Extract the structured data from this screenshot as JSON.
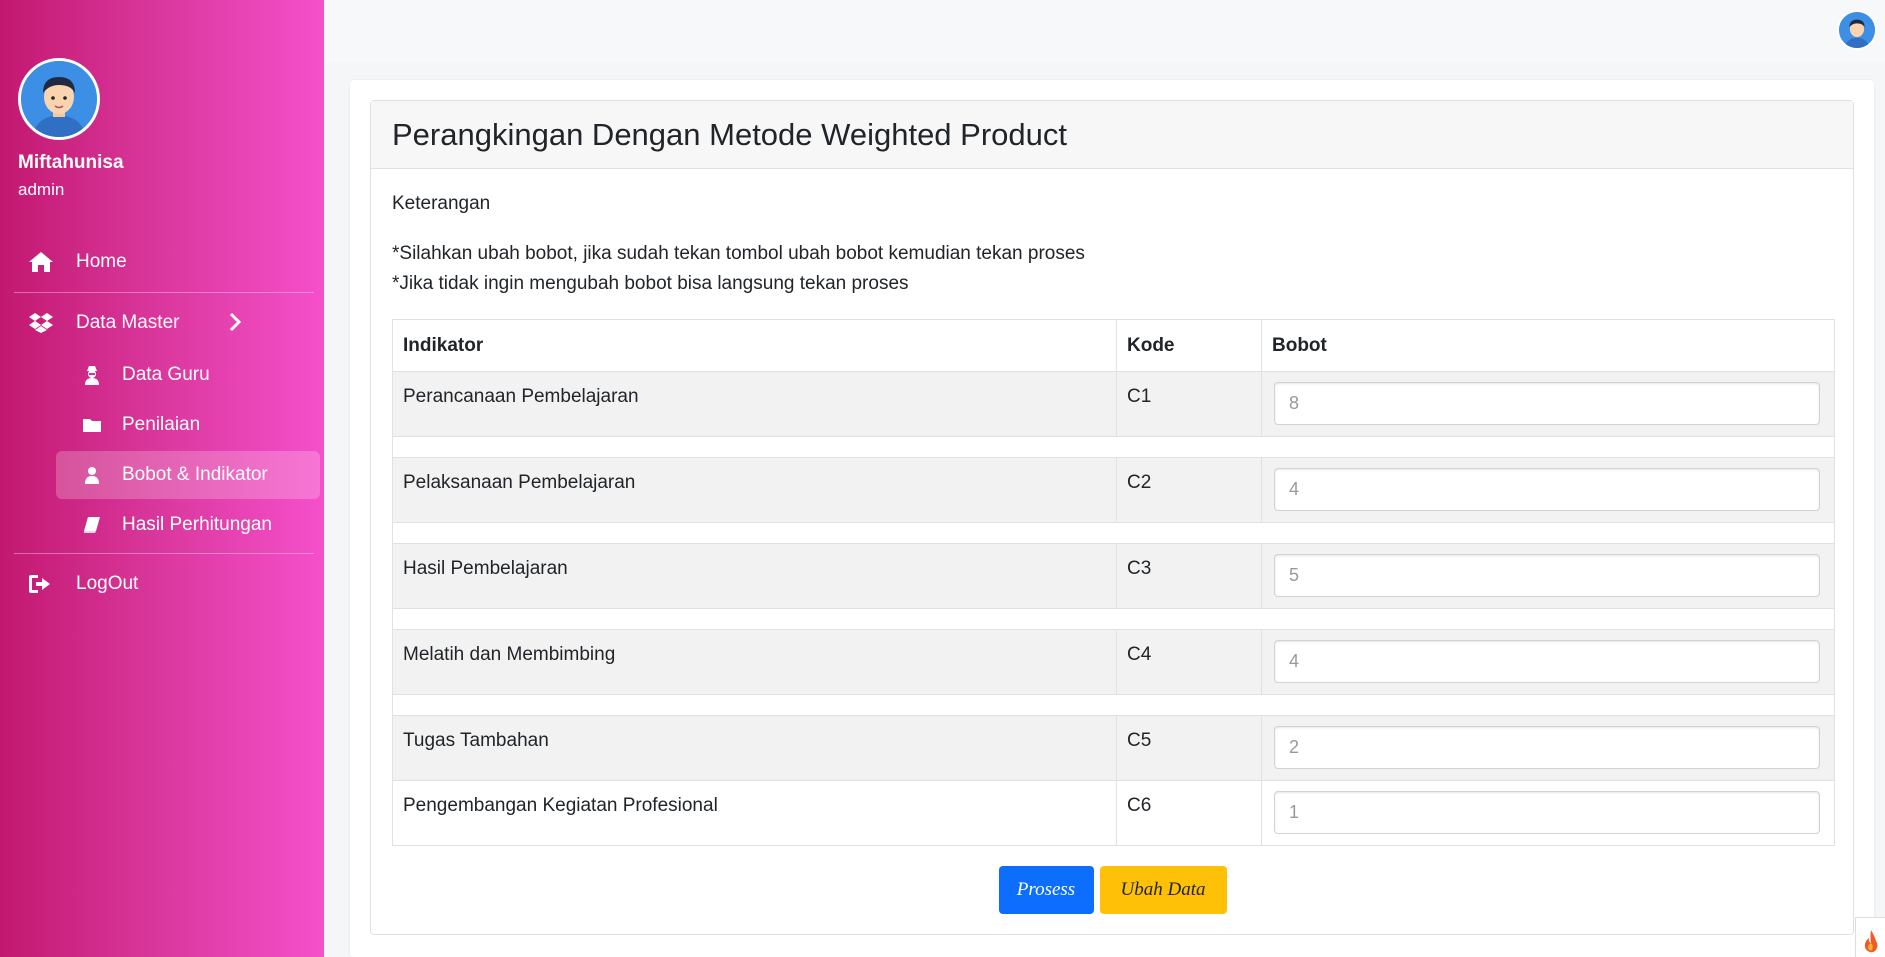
{
  "user": {
    "name": "Miftahunisa",
    "role": "admin"
  },
  "sidebar": {
    "home": "Home",
    "data_master": "Data Master",
    "sub_items": [
      {
        "label": "Data Guru",
        "icon": "user-secret-icon"
      },
      {
        "label": "Penilaian",
        "icon": "folder-icon"
      },
      {
        "label": "Bobot & Indikator",
        "icon": "user-icon",
        "active": true
      },
      {
        "label": "Hasil Perhitungan",
        "icon": "book-icon"
      }
    ],
    "logout": "LogOut"
  },
  "page": {
    "title": "Perangkingan Dengan Metode Weighted Product",
    "keterangan": "Keterangan",
    "note1": "*Silahkan ubah bobot, jika sudah tekan tombol ubah bobot kemudian tekan proses",
    "note2": "*Jika tidak ingin mengubah bobot bisa langsung tekan proses"
  },
  "table": {
    "headers": [
      "Indikator",
      "Kode",
      "Bobot"
    ],
    "rows": [
      {
        "indikator": "Perancanaan Pembelajaran",
        "kode": "C1",
        "bobot": "8"
      },
      {
        "indikator": "Pelaksanaan Pembelajaran",
        "kode": "C2",
        "bobot": "4"
      },
      {
        "indikator": "Hasil Pembelajaran",
        "kode": "C3",
        "bobot": "5"
      },
      {
        "indikator": "Melatih dan Membimbing",
        "kode": "C4",
        "bobot": "4"
      },
      {
        "indikator": "Tugas Tambahan",
        "kode": "C5",
        "bobot": "2"
      },
      {
        "indikator": "Pengembangan Kegiatan Profesional",
        "kode": "C6",
        "bobot": "1"
      }
    ]
  },
  "buttons": {
    "process": "Prosess",
    "edit": "Ubah Data"
  },
  "colors": {
    "sidebar_start": "#c2186f",
    "sidebar_end": "#f550cb",
    "primary": "#0d6efd",
    "warning": "#ffc107"
  }
}
